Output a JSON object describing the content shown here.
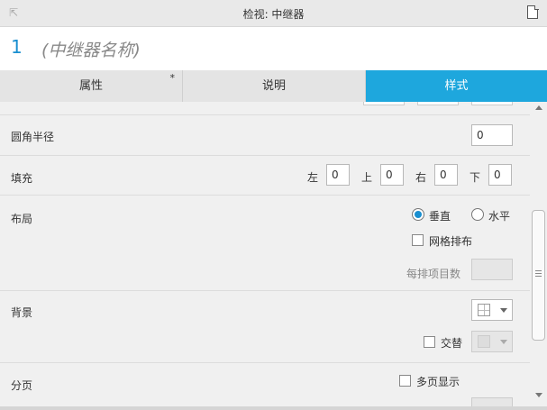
{
  "titlebar": {
    "title": "检视: 中继器"
  },
  "name_bar": {
    "number": "1",
    "name": "(中继器名称)"
  },
  "tabs": [
    {
      "label": "属性",
      "modified_marker": "*",
      "active": false
    },
    {
      "label": "说明",
      "active": false
    },
    {
      "label": "样式",
      "active": true
    }
  ],
  "sections": {
    "corner_radius": {
      "label": "圆角半径",
      "value": "0"
    },
    "padding": {
      "label": "填充",
      "left_label": "左",
      "left_value": "0",
      "top_label": "上",
      "top_value": "0",
      "right_label": "右",
      "right_value": "0",
      "bottom_label": "下",
      "bottom_value": "0"
    },
    "layout": {
      "label": "布局",
      "vertical_label": "垂直",
      "vertical_selected": true,
      "horizontal_label": "水平",
      "grid_label": "网格排布",
      "grid_checked": false,
      "items_per_row_label": "每排项目数",
      "items_per_row_value": ""
    },
    "background": {
      "label": "背景",
      "alternate_label": "交替",
      "alternate_checked": false
    },
    "paging": {
      "label": "分页",
      "multipage_label": "多页显示",
      "multipage_checked": false
    }
  },
  "colors": {
    "accent": "#1ea7dd",
    "number": "#1a8fd0"
  }
}
